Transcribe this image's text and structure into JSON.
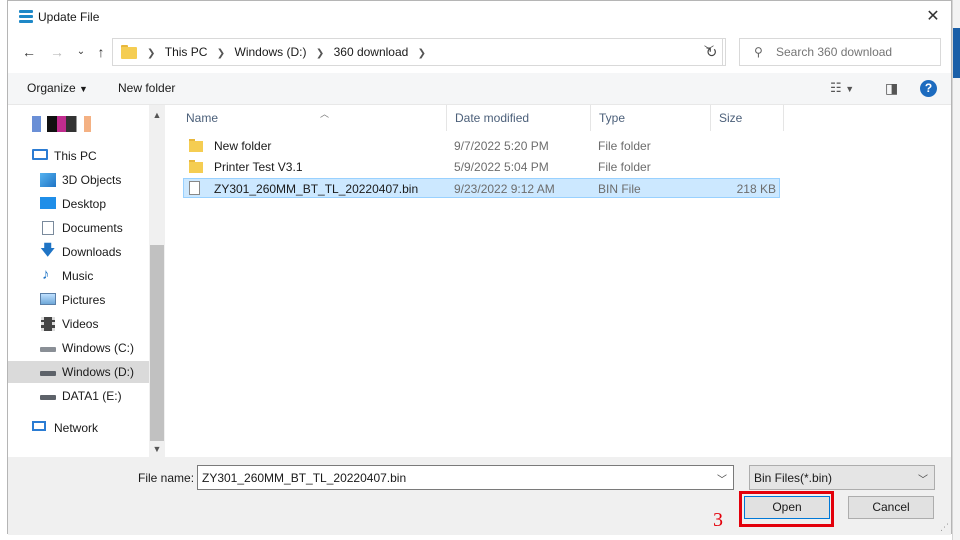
{
  "window": {
    "title": "Update File"
  },
  "nav": {
    "breadcrumbs": [
      "This PC",
      "Windows (D:)",
      "360 download"
    ],
    "search_placeholder": "Search 360 download"
  },
  "toolbar": {
    "organize": "Organize",
    "new_folder": "New folder"
  },
  "sidebar": {
    "items": [
      {
        "label": "This PC",
        "icon": "pc-icon"
      },
      {
        "label": "3D Objects",
        "icon": "cube-icon"
      },
      {
        "label": "Desktop",
        "icon": "desktop-icon"
      },
      {
        "label": "Documents",
        "icon": "document-icon"
      },
      {
        "label": "Downloads",
        "icon": "download-icon"
      },
      {
        "label": "Music",
        "icon": "music-note-icon"
      },
      {
        "label": "Pictures",
        "icon": "picture-icon"
      },
      {
        "label": "Videos",
        "icon": "film-icon"
      },
      {
        "label": "Windows (C:)",
        "icon": "drive-icon"
      },
      {
        "label": "Windows (D:)",
        "icon": "drive-icon",
        "selected": true
      },
      {
        "label": "DATA1 (E:)",
        "icon": "drive-icon"
      },
      {
        "label": "Network",
        "icon": "network-icon"
      }
    ]
  },
  "columns": {
    "name": "Name",
    "date": "Date modified",
    "type": "Type",
    "size": "Size"
  },
  "files": [
    {
      "name": "New folder",
      "date": "9/7/2022 5:20 PM",
      "type": "File folder",
      "size": "",
      "kind": "folder"
    },
    {
      "name": "Printer Test V3.1",
      "date": "5/9/2022 5:04 PM",
      "type": "File folder",
      "size": "",
      "kind": "folder"
    },
    {
      "name": "ZY301_260MM_BT_TL_20220407.bin",
      "date": "9/23/2022 9:12 AM",
      "type": "BIN File",
      "size": "218 KB",
      "kind": "file",
      "selected": true
    }
  ],
  "bottom": {
    "file_name_label": "File name:",
    "file_name_value": "ZY301_260MM_BT_TL_20220407.bin",
    "file_type_value": "Bin Files(*.bin)",
    "open_label": "Open",
    "cancel_label": "Cancel",
    "step_annotation": "3"
  },
  "colors": {
    "accent": "#0078d7",
    "selection": "#cce8ff",
    "annotation": "#e3000b",
    "folder": "#f5cd52"
  }
}
